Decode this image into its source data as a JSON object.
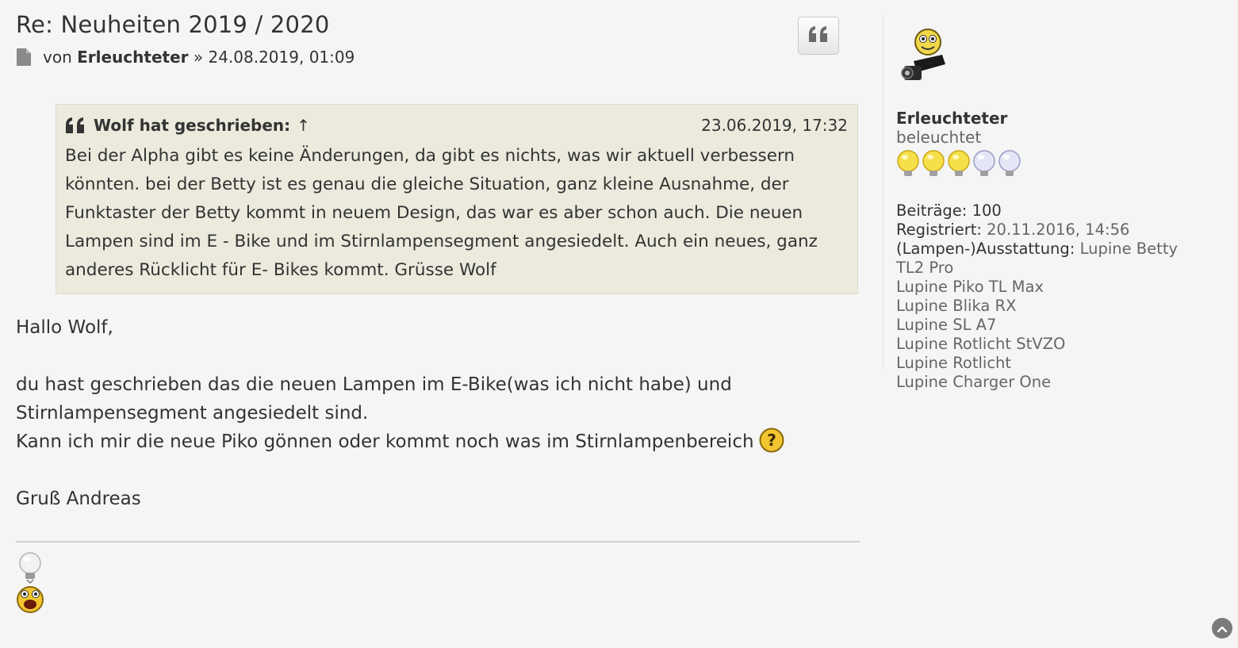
{
  "post": {
    "title": "Re: Neuheiten 2019 / 2020",
    "by_label": "von",
    "author": "Erleuchteter",
    "separator": "»",
    "datetime": "24.08.2019, 01:09",
    "quote_button_icon": "quote-icon"
  },
  "quote": {
    "author_label": "Wolf hat geschrieben:",
    "arrow": "↑",
    "date": "23.06.2019, 17:32",
    "text": "Bei der Alpha gibt es keine Änderungen, da gibt es nichts, was wir aktuell verbessern könnten. bei der Betty ist es genau die gleiche Situation, ganz kleine Ausnahme, der Funktaster der Betty kommt in neuem Design, das war es aber schon auch. Die neuen Lampen sind im E - Bike und im Stirnlampensegment angesiedelt. Auch ein neues, ganz anderes Rücklicht für E- Bikes kommt. Grüsse Wolf"
  },
  "body": {
    "greeting": "Hallo Wolf,",
    "line1": "du hast geschrieben das die neuen Lampen im E-Bike(was ich nicht habe) und",
    "line2": "Stirnlampensegment angesiedelt sind.",
    "line3": "Kann ich mir die neue Piko gönnen oder kommt noch was im Stirnlampenbereich",
    "signoff": "Gruß Andreas"
  },
  "profile": {
    "username": "Erleuchteter",
    "rank": "beleuchtet",
    "posts_label": "Beiträge:",
    "posts_value": "100",
    "registered_label": "Registriert:",
    "registered_value": "20.11.2016, 14:56",
    "equipment_label": "(Lampen-)Ausstattung:",
    "equipment_first": "Lupine Betty",
    "equipment": [
      "TL2 Pro",
      "Lupine Piko TL Max",
      "Lupine Blika RX",
      "Lupine SL A7",
      "Lupine Rotlicht StVZO",
      "Lupine Rotlicht",
      "Lupine Charger One"
    ]
  },
  "colors": {
    "background": "#f5f5f5",
    "quote_background": "#ebeadd",
    "text": "#333333",
    "muted": "#666666"
  }
}
